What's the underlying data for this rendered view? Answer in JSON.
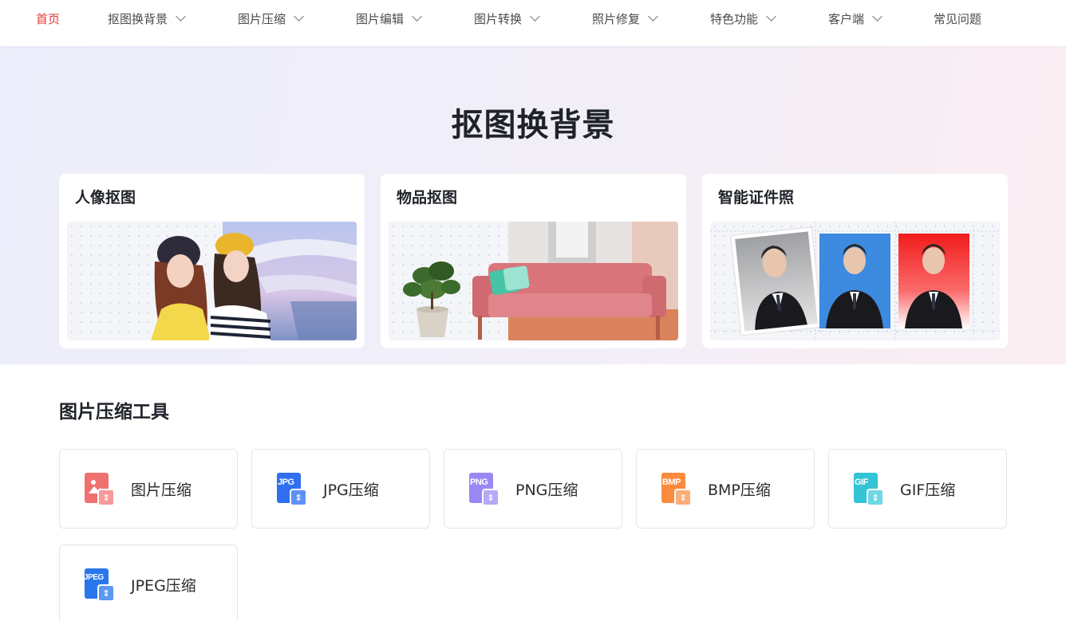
{
  "nav": {
    "items": [
      {
        "label": "首页",
        "active": true,
        "dropdown": false
      },
      {
        "label": "抠图换背景",
        "dropdown": true
      },
      {
        "label": "图片压缩",
        "dropdown": true
      },
      {
        "label": "图片编辑",
        "dropdown": true
      },
      {
        "label": "图片转换",
        "dropdown": true
      },
      {
        "label": "照片修复",
        "dropdown": true
      },
      {
        "label": "特色功能",
        "dropdown": true
      },
      {
        "label": "客户端",
        "dropdown": true
      },
      {
        "label": "常见问题",
        "dropdown": false
      }
    ]
  },
  "hero": {
    "title": "抠图换背景",
    "cards": [
      {
        "title": "人像抠图",
        "image": "portrait-cutout-photo"
      },
      {
        "title": "物品抠图",
        "image": "object-cutout-photo"
      },
      {
        "title": "智能证件照",
        "image": "id-photo-samples"
      }
    ]
  },
  "compress": {
    "title": "图片压缩工具",
    "tools": [
      {
        "label": "图片压缩",
        "icon": "image-compress-icon",
        "color": "#f06b6b"
      },
      {
        "label": "JPG压缩",
        "icon": "jpg-compress-icon",
        "ext": "JPG",
        "color": "#2f6ff0"
      },
      {
        "label": "PNG压缩",
        "icon": "png-compress-icon",
        "ext": "PNG",
        "color": "#9b87f5"
      },
      {
        "label": "BMP压缩",
        "icon": "bmp-compress-icon",
        "ext": "BMP",
        "color": "#fb8a3c"
      },
      {
        "label": "GIF压缩",
        "icon": "gif-compress-icon",
        "ext": "GIF",
        "color": "#35c3d6"
      },
      {
        "label": "JPEG压缩",
        "icon": "jpeg-compress-icon",
        "ext": "JPEG",
        "color": "#2a76ec"
      }
    ]
  }
}
